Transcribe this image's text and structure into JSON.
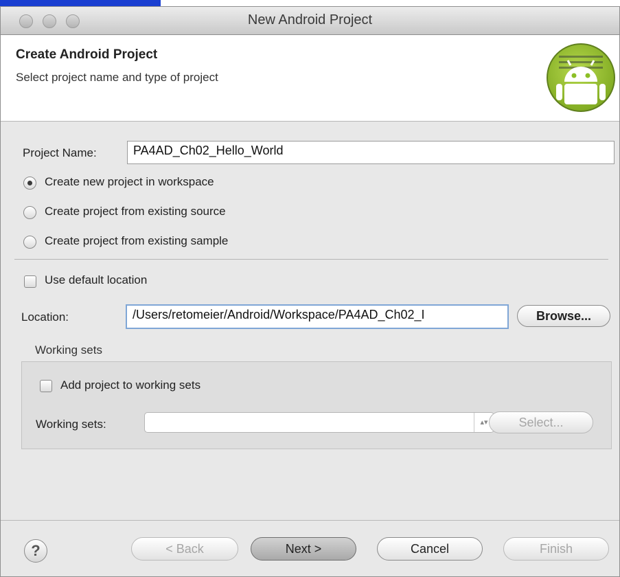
{
  "window": {
    "title": "New Android Project"
  },
  "banner": {
    "title": "Create Android Project",
    "description": "Select project name and type of project"
  },
  "form": {
    "project_name_label": "Project Name:",
    "project_name_value": "PA4AD_Ch02_Hello_World",
    "options": [
      {
        "label": "Create new project in workspace",
        "selected": true
      },
      {
        "label": "Create project from existing source",
        "selected": false
      },
      {
        "label": "Create project from existing sample",
        "selected": false
      }
    ],
    "use_default_location_label": "Use default location",
    "use_default_location_checked": false,
    "location_label": "Location:",
    "location_value": "/Users/retomeier/Android/Workspace/PA4AD_Ch02_I",
    "browse_label": "Browse...",
    "working_sets_group_label": "Working sets",
    "add_to_working_sets_label": "Add project to working sets",
    "add_to_working_sets_checked": false,
    "working_sets_label": "Working sets:",
    "working_sets_value": "",
    "select_label": "Select..."
  },
  "footer": {
    "help_label": "?",
    "back_label": "< Back",
    "next_label": "Next >",
    "cancel_label": "Cancel",
    "finish_label": "Finish"
  },
  "colors": {
    "link_bar": "#1a3fd1",
    "android_green": "#8cbf26"
  }
}
